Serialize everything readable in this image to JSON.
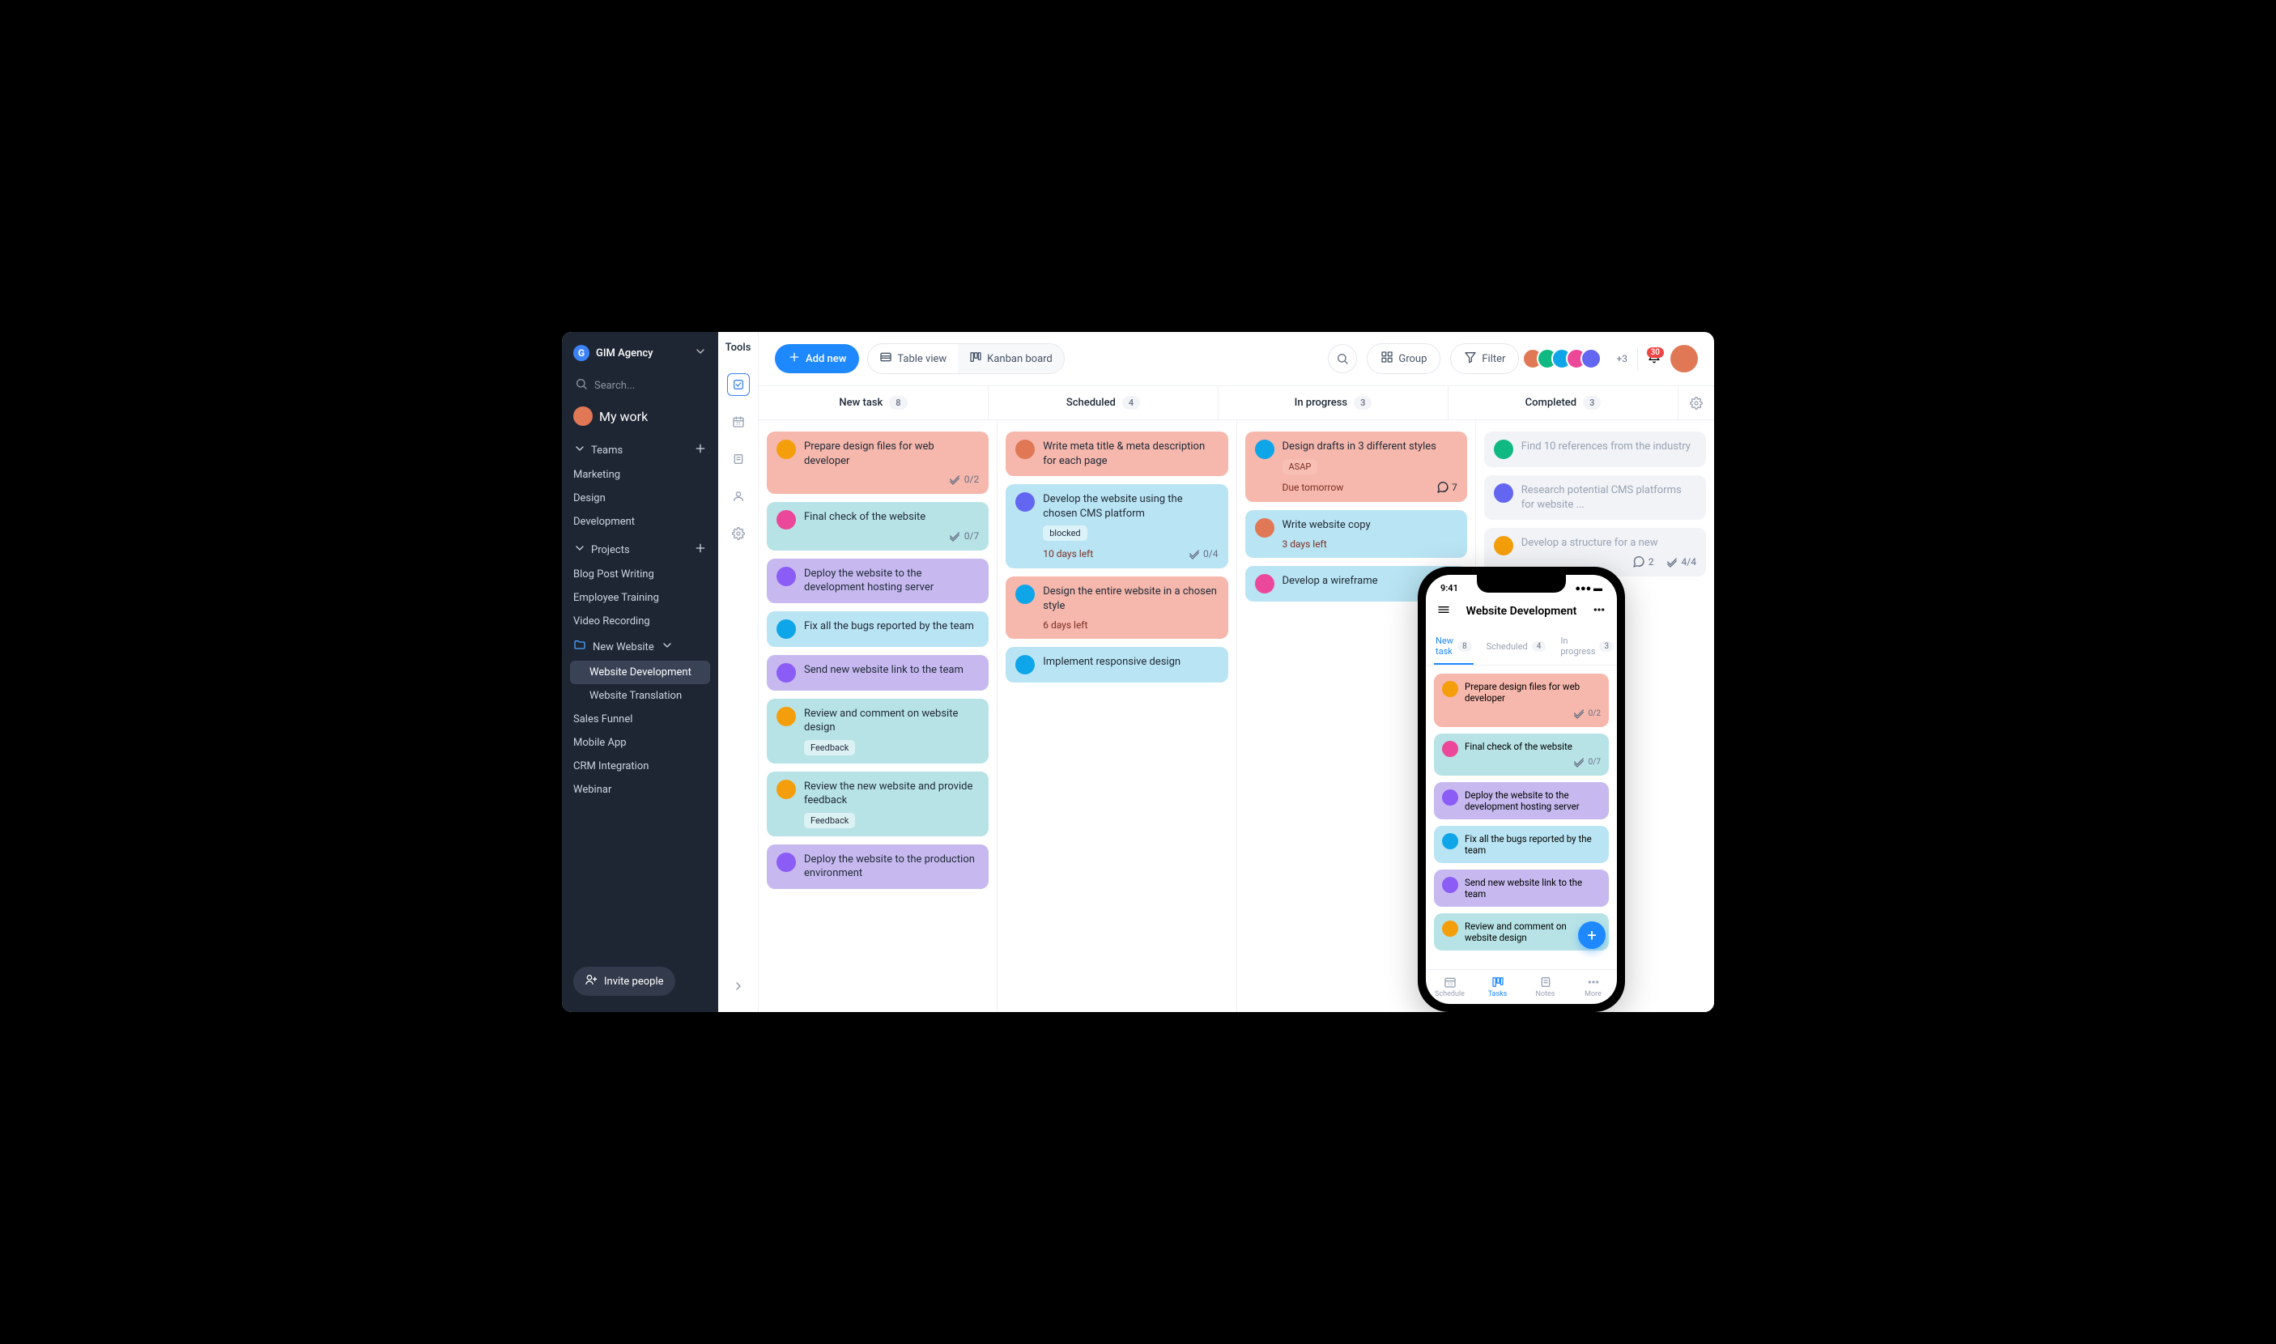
{
  "workspace": {
    "name": "GIM Agency"
  },
  "search": {
    "placeholder": "Search..."
  },
  "mywork": {
    "label": "My work"
  },
  "teams": {
    "header": "Teams",
    "items": [
      "Marketing",
      "Design",
      "Development"
    ]
  },
  "projects": {
    "header": "Projects",
    "items": [
      {
        "label": "Blog Post Writing"
      },
      {
        "label": "Employee Training"
      },
      {
        "label": "Video Recording"
      },
      {
        "label": "New Website",
        "folder": true,
        "children": [
          {
            "label": "Website Development",
            "active": true
          },
          {
            "label": "Website Translation"
          }
        ]
      },
      {
        "label": "Sales Funnel"
      },
      {
        "label": "Mobile App"
      },
      {
        "label": "CRM Integration"
      },
      {
        "label": "Webinar"
      }
    ]
  },
  "invite": {
    "label": "Invite people"
  },
  "rail": {
    "tools": "Tools"
  },
  "topbar": {
    "addnew": "Add new",
    "tableview": "Table view",
    "kanban": "Kanban board",
    "group": "Group",
    "filter": "Filter",
    "avmore": "+3",
    "notif": "30"
  },
  "columns": [
    {
      "name": "New task",
      "count": "8"
    },
    {
      "name": "Scheduled",
      "count": "4"
    },
    {
      "name": "In progress",
      "count": "3"
    },
    {
      "name": "Completed",
      "count": "3"
    }
  ],
  "board": {
    "newtask": [
      {
        "t": "Prepare design files for web developer",
        "c": "c-salmon",
        "av": "a4",
        "sub": "0/2",
        "subicon": "check"
      },
      {
        "t": "Final check of the website",
        "c": "c-teal",
        "av": "a6",
        "sub": "0/7",
        "subicon": "check"
      },
      {
        "t": "Deploy the website to the development hosting server",
        "c": "c-purple",
        "av": "a2"
      },
      {
        "t": "Fix all the bugs reported by the team",
        "c": "c-blue",
        "av": "a3"
      },
      {
        "t": "Send new website link to the team",
        "c": "c-purple",
        "av": "a2"
      },
      {
        "t": "Review and comment on website design",
        "c": "c-teal",
        "av": "a4",
        "tag": "Feedback"
      },
      {
        "t": "Review the new website and provide feedback",
        "c": "c-teal",
        "av": "a4",
        "tag": "Feedback"
      },
      {
        "t": "Deploy the website to the production environment",
        "c": "c-purple",
        "av": "a2"
      }
    ],
    "scheduled": [
      {
        "t": "Write meta title & meta description for each page",
        "c": "c-salmon",
        "av": "a1"
      },
      {
        "t": "Develop the website using the chosen CMS platform",
        "c": "c-blue",
        "av": "a7",
        "tag": "blocked",
        "due": "10 days left",
        "sub": "0/4",
        "subicon": "check"
      },
      {
        "t": "Design the entire website in a chosen style",
        "c": "c-salmon",
        "av": "a3",
        "due": "6 days left"
      },
      {
        "t": "Implement responsive design",
        "c": "c-blue",
        "av": "a3"
      }
    ],
    "inprogress": [
      {
        "t": "Design drafts in 3 different styles",
        "c": "c-salmon",
        "av": "a3",
        "tag": "ASAP",
        "tagc": "asap",
        "due": "Due tomorrow",
        "comments": "7"
      },
      {
        "t": "Write website copy",
        "c": "c-blue",
        "av": "a1",
        "due": "3 days left"
      },
      {
        "t": "Develop a wireframe",
        "c": "c-blue",
        "av": "a6"
      }
    ],
    "completed": [
      {
        "t": "Find 10 references from the industry",
        "c": "c-gray",
        "av": "a5"
      },
      {
        "t": "Research potential CMS platforms for website ...",
        "c": "c-gray",
        "av": "a7"
      },
      {
        "t": "Develop a structure for a new",
        "c": "c-gray",
        "av": "a4",
        "metaL": "2",
        "metaR": "4/4"
      }
    ]
  },
  "phone": {
    "time": "9:41",
    "title": "Website Development",
    "tabs": [
      {
        "name": "New task",
        "count": "8",
        "active": true
      },
      {
        "name": "Scheduled",
        "count": "4"
      },
      {
        "name": "In progress",
        "count": "3"
      }
    ],
    "cards": [
      {
        "t": "Prepare design files for web developer",
        "c": "c-salmon",
        "av": "a4",
        "sub": "0/2"
      },
      {
        "t": "Final check of the website",
        "c": "c-teal",
        "av": "a6",
        "sub": "0/7"
      },
      {
        "t": "Deploy the website to the development hosting server",
        "c": "c-purple",
        "av": "a2"
      },
      {
        "t": "Fix all the bugs reported by the team",
        "c": "c-blue",
        "av": "a3"
      },
      {
        "t": "Send new website link to the team",
        "c": "c-purple",
        "av": "a2"
      },
      {
        "t": "Review and comment on website design",
        "c": "c-teal",
        "av": "a4"
      }
    ],
    "nav": [
      {
        "label": "Schedule"
      },
      {
        "label": "Tasks",
        "active": true
      },
      {
        "label": "Notes"
      },
      {
        "label": "More"
      }
    ]
  }
}
